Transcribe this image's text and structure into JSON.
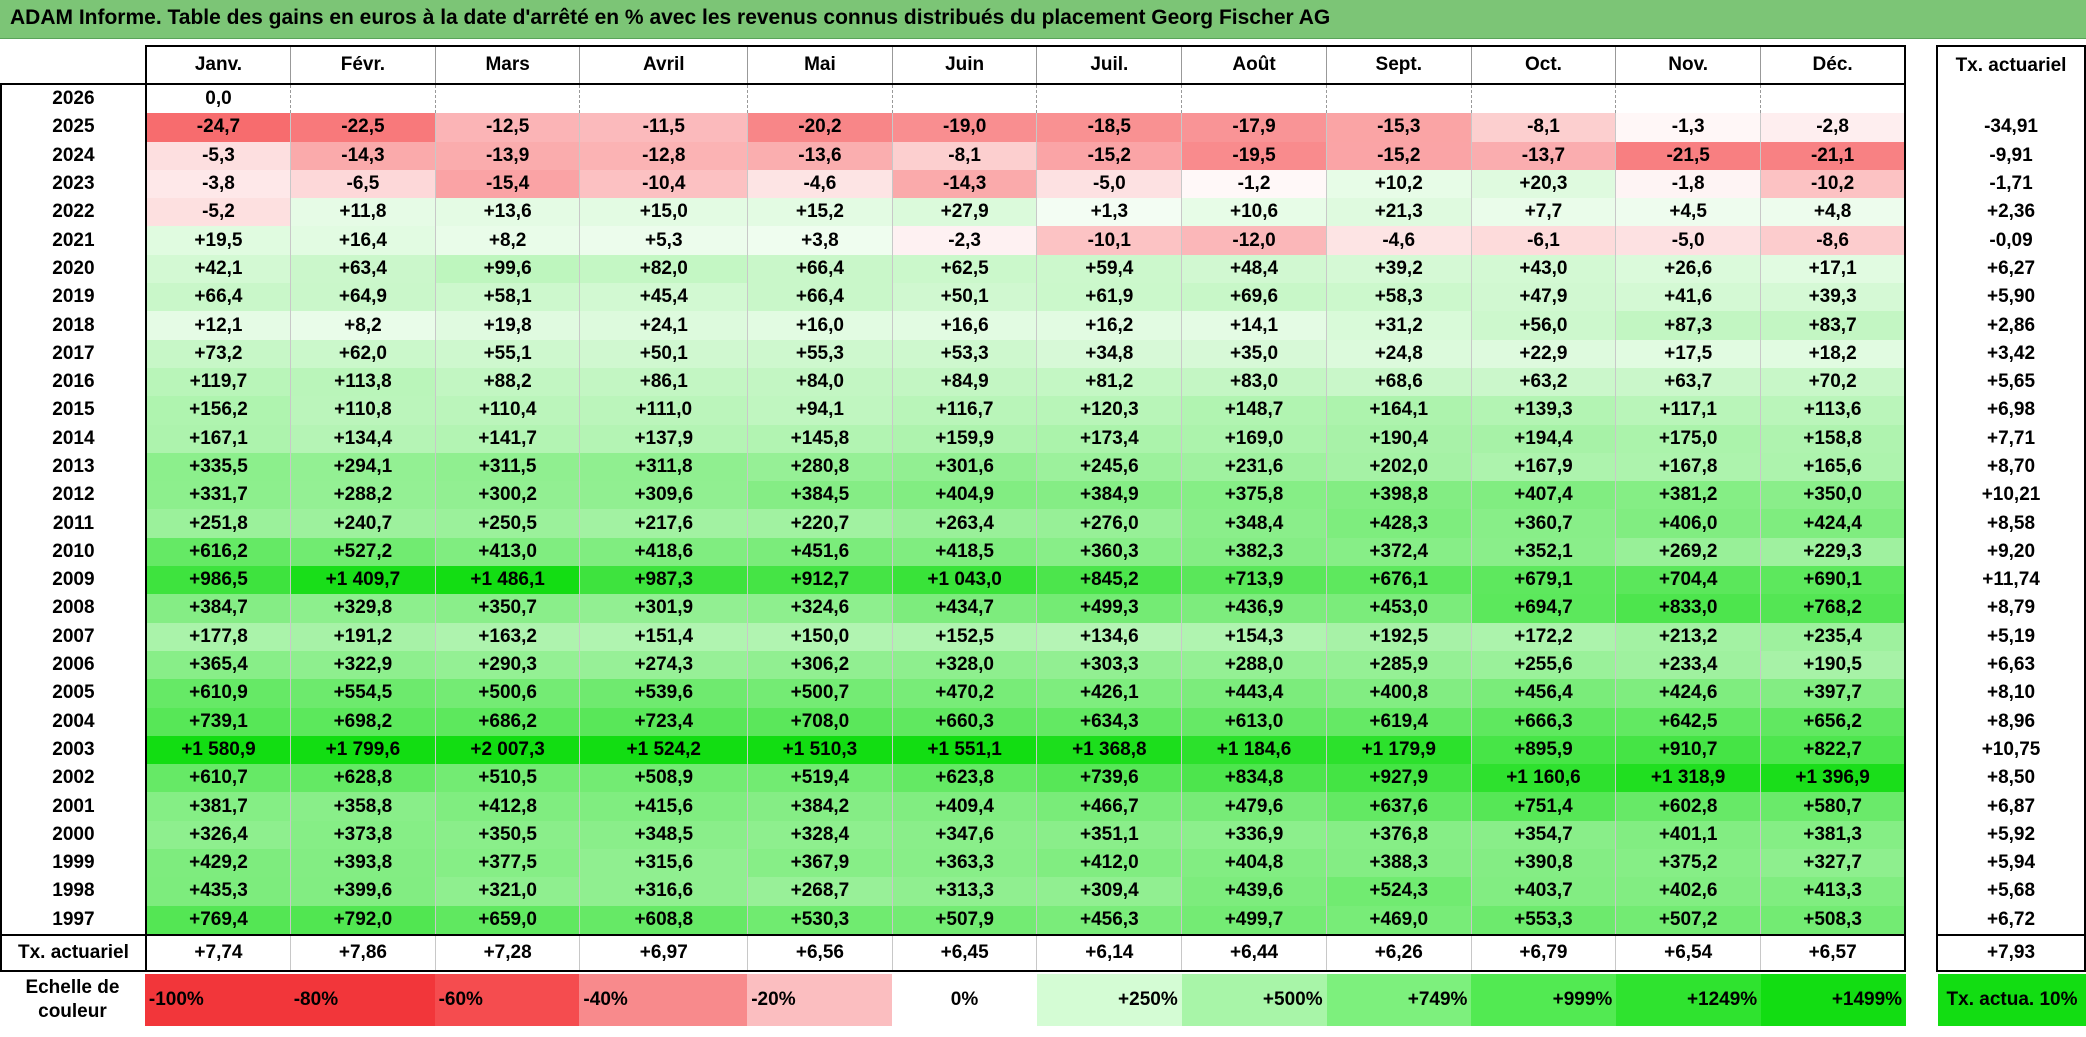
{
  "title": "ADAM Informe. Table des gains en euros à la date d'arrêté en % avec les revenus connus distribués du placement Georg Fischer AG",
  "headers": {
    "months": [
      "Janv.",
      "Févr.",
      "Mars",
      "Avril",
      "Mai",
      "Juin",
      "Juil.",
      "Août",
      "Sept.",
      "Oct.",
      "Nov.",
      "Déc."
    ],
    "rate": "Tx. actuariel"
  },
  "rows": [
    {
      "year": "2026",
      "values": [
        "0,0",
        "",
        "",
        "",
        "",
        "",
        "",
        "",
        "",
        "",
        "",
        ""
      ],
      "rate": ""
    },
    {
      "year": "2025",
      "values": [
        "-24,7",
        "-22,5",
        "-12,5",
        "-11,5",
        "-20,2",
        "-19,0",
        "-18,5",
        "-17,9",
        "-15,3",
        "-8,1",
        "-1,3",
        "-2,8"
      ],
      "rate": "-34,91"
    },
    {
      "year": "2024",
      "values": [
        "-5,3",
        "-14,3",
        "-13,9",
        "-12,8",
        "-13,6",
        "-8,1",
        "-15,2",
        "-19,5",
        "-15,2",
        "-13,7",
        "-21,5",
        "-21,1"
      ],
      "rate": "-9,91"
    },
    {
      "year": "2023",
      "values": [
        "-3,8",
        "-6,5",
        "-15,4",
        "-10,4",
        "-4,6",
        "-14,3",
        "-5,0",
        "-1,2",
        "+10,2",
        "+20,3",
        "-1,8",
        "-10,2"
      ],
      "rate": "-1,71"
    },
    {
      "year": "2022",
      "values": [
        "-5,2",
        "+11,8",
        "+13,6",
        "+15,0",
        "+15,2",
        "+27,9",
        "+1,3",
        "+10,6",
        "+21,3",
        "+7,7",
        "+4,5",
        "+4,8"
      ],
      "rate": "+2,36"
    },
    {
      "year": "2021",
      "values": [
        "+19,5",
        "+16,4",
        "+8,2",
        "+5,3",
        "+3,8",
        "-2,3",
        "-10,1",
        "-12,0",
        "-4,6",
        "-6,1",
        "-5,0",
        "-8,6"
      ],
      "rate": "-0,09"
    },
    {
      "year": "2020",
      "values": [
        "+42,1",
        "+63,4",
        "+99,6",
        "+82,0",
        "+66,4",
        "+62,5",
        "+59,4",
        "+48,4",
        "+39,2",
        "+43,0",
        "+26,6",
        "+17,1"
      ],
      "rate": "+6,27"
    },
    {
      "year": "2019",
      "values": [
        "+66,4",
        "+64,9",
        "+58,1",
        "+45,4",
        "+66,4",
        "+50,1",
        "+61,9",
        "+69,6",
        "+58,3",
        "+47,9",
        "+41,6",
        "+39,3"
      ],
      "rate": "+5,90"
    },
    {
      "year": "2018",
      "values": [
        "+12,1",
        "+8,2",
        "+19,8",
        "+24,1",
        "+16,0",
        "+16,6",
        "+16,2",
        "+14,1",
        "+31,2",
        "+56,0",
        "+87,3",
        "+83,7"
      ],
      "rate": "+2,86"
    },
    {
      "year": "2017",
      "values": [
        "+73,2",
        "+62,0",
        "+55,1",
        "+50,1",
        "+55,3",
        "+53,3",
        "+34,8",
        "+35,0",
        "+24,8",
        "+22,9",
        "+17,5",
        "+18,2"
      ],
      "rate": "+3,42"
    },
    {
      "year": "2016",
      "values": [
        "+119,7",
        "+113,8",
        "+88,2",
        "+86,1",
        "+84,0",
        "+84,9",
        "+81,2",
        "+83,0",
        "+68,6",
        "+63,2",
        "+63,7",
        "+70,2"
      ],
      "rate": "+5,65"
    },
    {
      "year": "2015",
      "values": [
        "+156,2",
        "+110,8",
        "+110,4",
        "+111,0",
        "+94,1",
        "+116,7",
        "+120,3",
        "+148,7",
        "+164,1",
        "+139,3",
        "+117,1",
        "+113,6"
      ],
      "rate": "+6,98"
    },
    {
      "year": "2014",
      "values": [
        "+167,1",
        "+134,4",
        "+141,7",
        "+137,9",
        "+145,8",
        "+159,9",
        "+173,4",
        "+169,0",
        "+190,4",
        "+194,4",
        "+175,0",
        "+158,8"
      ],
      "rate": "+7,71"
    },
    {
      "year": "2013",
      "values": [
        "+335,5",
        "+294,1",
        "+311,5",
        "+311,8",
        "+280,8",
        "+301,6",
        "+245,6",
        "+231,6",
        "+202,0",
        "+167,9",
        "+167,8",
        "+165,6"
      ],
      "rate": "+8,70"
    },
    {
      "year": "2012",
      "values": [
        "+331,7",
        "+288,2",
        "+300,2",
        "+309,6",
        "+384,5",
        "+404,9",
        "+384,9",
        "+375,8",
        "+398,8",
        "+407,4",
        "+381,2",
        "+350,0"
      ],
      "rate": "+10,21"
    },
    {
      "year": "2011",
      "values": [
        "+251,8",
        "+240,7",
        "+250,5",
        "+217,6",
        "+220,7",
        "+263,4",
        "+276,0",
        "+348,4",
        "+428,3",
        "+360,7",
        "+406,0",
        "+424,4"
      ],
      "rate": "+8,58"
    },
    {
      "year": "2010",
      "values": [
        "+616,2",
        "+527,2",
        "+413,0",
        "+418,6",
        "+451,6",
        "+418,5",
        "+360,3",
        "+382,3",
        "+372,4",
        "+352,1",
        "+269,2",
        "+229,3"
      ],
      "rate": "+9,20"
    },
    {
      "year": "2009",
      "values": [
        "+986,5",
        "+1 409,7",
        "+1 486,1",
        "+987,3",
        "+912,7",
        "+1 043,0",
        "+845,2",
        "+713,9",
        "+676,1",
        "+679,1",
        "+704,4",
        "+690,1"
      ],
      "rate": "+11,74"
    },
    {
      "year": "2008",
      "values": [
        "+384,7",
        "+329,8",
        "+350,7",
        "+301,9",
        "+324,6",
        "+434,7",
        "+499,3",
        "+436,9",
        "+453,0",
        "+694,7",
        "+833,0",
        "+768,2"
      ],
      "rate": "+8,79"
    },
    {
      "year": "2007",
      "values": [
        "+177,8",
        "+191,2",
        "+163,2",
        "+151,4",
        "+150,0",
        "+152,5",
        "+134,6",
        "+154,3",
        "+192,5",
        "+172,2",
        "+213,2",
        "+235,4"
      ],
      "rate": "+5,19"
    },
    {
      "year": "2006",
      "values": [
        "+365,4",
        "+322,9",
        "+290,3",
        "+274,3",
        "+306,2",
        "+328,0",
        "+303,3",
        "+288,0",
        "+285,9",
        "+255,6",
        "+233,4",
        "+190,5"
      ],
      "rate": "+6,63"
    },
    {
      "year": "2005",
      "values": [
        "+610,9",
        "+554,5",
        "+500,6",
        "+539,6",
        "+500,7",
        "+470,2",
        "+426,1",
        "+443,4",
        "+400,8",
        "+456,4",
        "+424,6",
        "+397,7"
      ],
      "rate": "+8,10"
    },
    {
      "year": "2004",
      "values": [
        "+739,1",
        "+698,2",
        "+686,2",
        "+723,4",
        "+708,0",
        "+660,3",
        "+634,3",
        "+613,0",
        "+619,4",
        "+666,3",
        "+642,5",
        "+656,2"
      ],
      "rate": "+8,96"
    },
    {
      "year": "2003",
      "values": [
        "+1 580,9",
        "+1 799,6",
        "+2 007,3",
        "+1 524,2",
        "+1 510,3",
        "+1 551,1",
        "+1 368,8",
        "+1 184,6",
        "+1 179,9",
        "+895,9",
        "+910,7",
        "+822,7"
      ],
      "rate": "+10,75"
    },
    {
      "year": "2002",
      "values": [
        "+610,7",
        "+628,8",
        "+510,5",
        "+508,9",
        "+519,4",
        "+623,8",
        "+739,6",
        "+834,8",
        "+927,9",
        "+1 160,6",
        "+1 318,9",
        "+1 396,9"
      ],
      "rate": "+8,50"
    },
    {
      "year": "2001",
      "values": [
        "+381,7",
        "+358,8",
        "+412,8",
        "+415,6",
        "+384,2",
        "+409,4",
        "+466,7",
        "+479,6",
        "+637,6",
        "+751,4",
        "+602,8",
        "+580,7"
      ],
      "rate": "+6,87"
    },
    {
      "year": "2000",
      "values": [
        "+326,4",
        "+373,8",
        "+350,5",
        "+348,5",
        "+328,4",
        "+347,6",
        "+351,1",
        "+336,9",
        "+376,8",
        "+354,7",
        "+401,1",
        "+381,3"
      ],
      "rate": "+5,92"
    },
    {
      "year": "1999",
      "values": [
        "+429,2",
        "+393,8",
        "+377,5",
        "+315,6",
        "+367,9",
        "+363,3",
        "+412,0",
        "+404,8",
        "+388,3",
        "+390,8",
        "+375,2",
        "+327,7"
      ],
      "rate": "+5,94"
    },
    {
      "year": "1998",
      "values": [
        "+435,3",
        "+399,6",
        "+321,0",
        "+316,6",
        "+268,7",
        "+313,3",
        "+309,4",
        "+439,6",
        "+524,3",
        "+403,7",
        "+402,6",
        "+413,3"
      ],
      "rate": "+5,68"
    },
    {
      "year": "1997",
      "values": [
        "+769,4",
        "+792,0",
        "+659,0",
        "+608,8",
        "+530,3",
        "+507,9",
        "+456,3",
        "+499,7",
        "+469,0",
        "+553,3",
        "+507,2",
        "+508,3"
      ],
      "rate": "+6,72"
    }
  ],
  "footer": {
    "label": "Tx. actuariel",
    "values": [
      "+7,74",
      "+7,86",
      "+7,28",
      "+6,97",
      "+6,56",
      "+6,45",
      "+6,14",
      "+6,44",
      "+6,26",
      "+6,79",
      "+6,54",
      "+6,57"
    ],
    "total": "+7,93"
  },
  "legend": {
    "title": "Echelle de couleur",
    "items": [
      {
        "label": "-100%",
        "color": "#f2363a",
        "kind": "neg"
      },
      {
        "label": "-80%",
        "color": "#f2363a",
        "kind": "neg"
      },
      {
        "label": "-60%",
        "color": "#f54c4f",
        "kind": "neg"
      },
      {
        "label": "-40%",
        "color": "#f88a8c",
        "kind": "neg"
      },
      {
        "label": "-20%",
        "color": "#fbbec0",
        "kind": "neg"
      },
      {
        "label": "0%",
        "color": "#ffffff",
        "kind": "zero"
      },
      {
        "label": "+250%",
        "color": "#d4fcd4",
        "kind": "pos"
      },
      {
        "label": "+500%",
        "color": "#a8f5a8",
        "kind": "pos"
      },
      {
        "label": "+749%",
        "color": "#7df07d",
        "kind": "pos"
      },
      {
        "label": "+999%",
        "color": "#52ea52",
        "kind": "pos"
      },
      {
        "label": "+1249%",
        "color": "#2fe32f",
        "kind": "pos"
      },
      {
        "label": "+1499%",
        "color": "#12dd12",
        "kind": "pos"
      }
    ],
    "tx_label": "Tx. actua. 10%",
    "tx_color": "#12dd12"
  },
  "colors": {
    "title_bar": "#7cc576",
    "negative_max": "#f54c4f",
    "positive_max": "#12dd12",
    "neutral": "#ffffff"
  }
}
